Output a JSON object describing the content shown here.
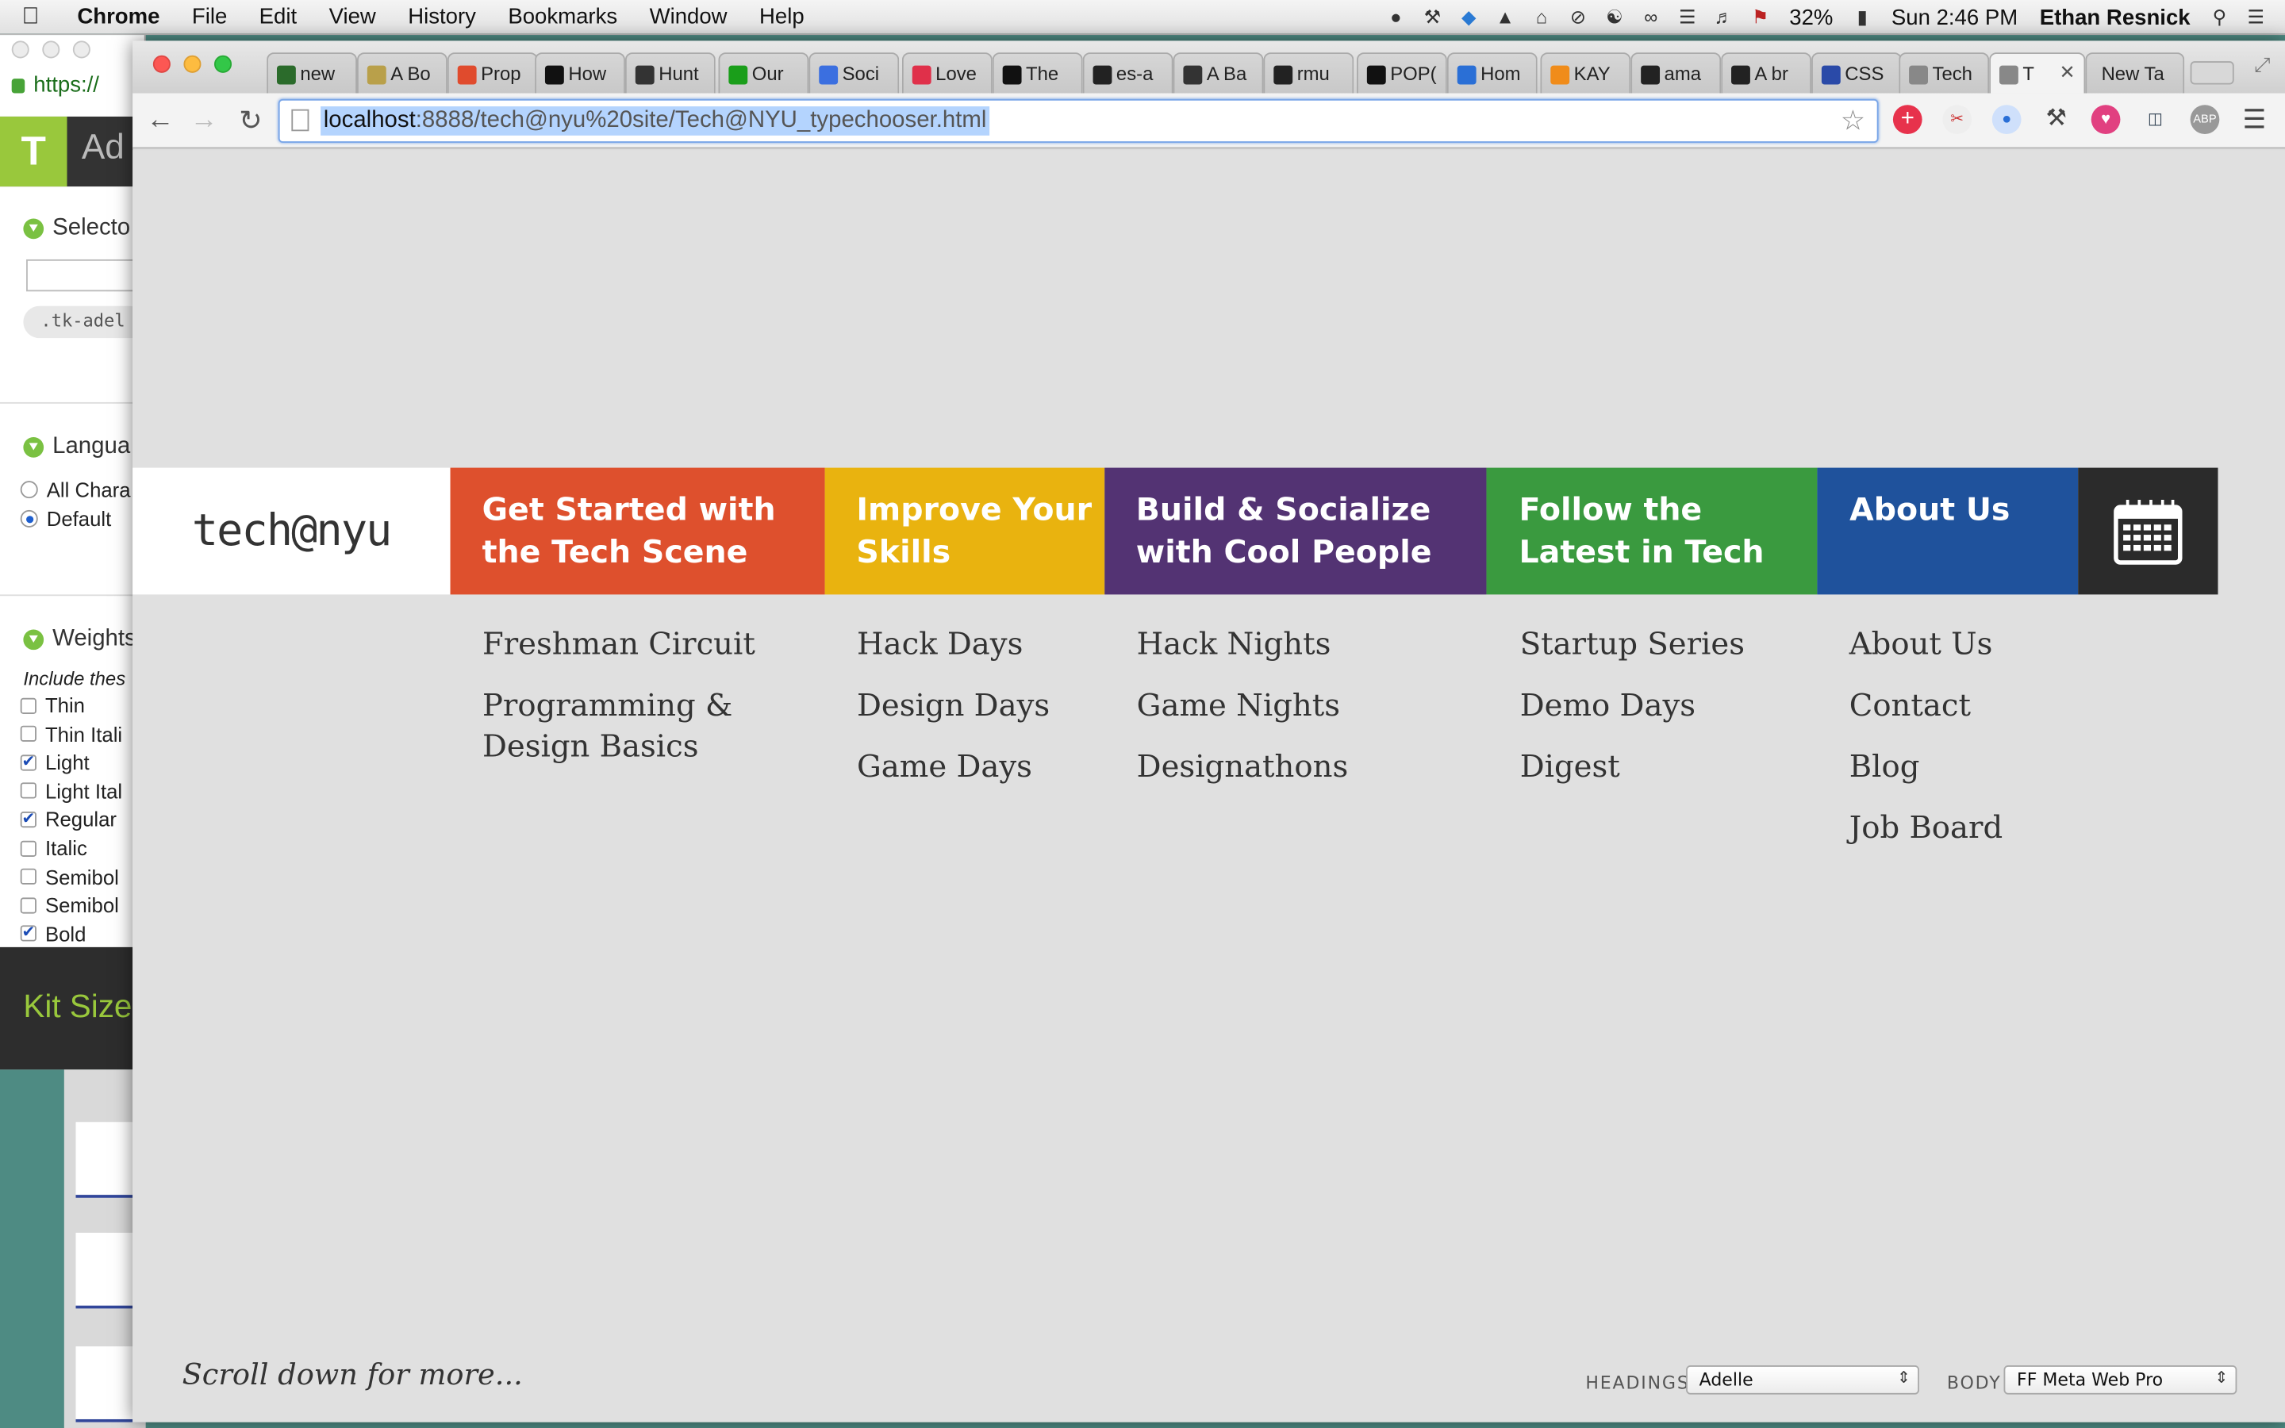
{
  "menubar": {
    "app": "Chrome",
    "menus": [
      "File",
      "Edit",
      "View",
      "History",
      "Bookmarks",
      "Window",
      "Help"
    ],
    "battery": "32%",
    "clock": "Sun 2:46 PM",
    "user": "Ethan Resnick"
  },
  "typekit_window": {
    "url_fragment": "https://",
    "header_fragment": "Ad",
    "selectors_title": "Selecto",
    "selector_value": ".tk-adel",
    "language_title": "Langua",
    "language_options": [
      "All Chara",
      "Default"
    ],
    "weights_title": "Weights",
    "weights_hint": "Include thes",
    "weights": [
      {
        "label": "Thin",
        "checked": false
      },
      {
        "label": "Thin Itali",
        "checked": false
      },
      {
        "label": "Light",
        "checked": true
      },
      {
        "label": "Light Ital",
        "checked": false
      },
      {
        "label": "Regular",
        "checked": true
      },
      {
        "label": "Italic",
        "checked": false
      },
      {
        "label": "Semibol",
        "checked": false
      },
      {
        "label": "Semibol",
        "checked": false
      },
      {
        "label": "Bold",
        "checked": true
      }
    ],
    "kit_size": "Kit Size"
  },
  "browser": {
    "tabs": [
      "new",
      "A Bo",
      "Prop",
      "How",
      "Hunt",
      "Our",
      "Soci",
      "Love",
      "The",
      "es-a",
      "A Ba",
      "rmu",
      "POP(",
      "Hom",
      "KAY",
      "ama",
      "A br",
      "CSS",
      "Tech",
      "T",
      "New Ta"
    ],
    "url_host": "localhost",
    "url_rest": ":8888/tech@nyu%20site/Tech@NYU_typechooser.html"
  },
  "site": {
    "logo": "tech@nyu",
    "categories": [
      {
        "title": "Get Started with the Tech Scene",
        "color": "#de502d",
        "links": [
          "Freshman Circuit",
          "Programming & Design Basics"
        ]
      },
      {
        "title": "Improve Your Skills",
        "color": "#e9b30f",
        "links": [
          "Hack Days",
          "Design Days",
          "Game Days"
        ]
      },
      {
        "title": "Build & Socialize with Cool People",
        "color": "#533373",
        "links": [
          "Hack Nights",
          "Game Nights",
          "Designathons"
        ]
      },
      {
        "title": "Follow the Latest in Tech",
        "color": "#3a9a3f",
        "links": [
          "Startup Series",
          "Demo Days",
          "Digest"
        ]
      },
      {
        "title": "About Us",
        "color": "#1f529c",
        "links": [
          "About Us",
          "Contact",
          "Blog",
          "Job Board"
        ]
      }
    ],
    "calendar_icon": "calendar-icon",
    "scroll_hint": "Scroll down for more...",
    "headings_label": "HEADINGS",
    "headings_font": "Adelle",
    "body_label": "BODY",
    "body_font": "FF Meta Web Pro"
  }
}
